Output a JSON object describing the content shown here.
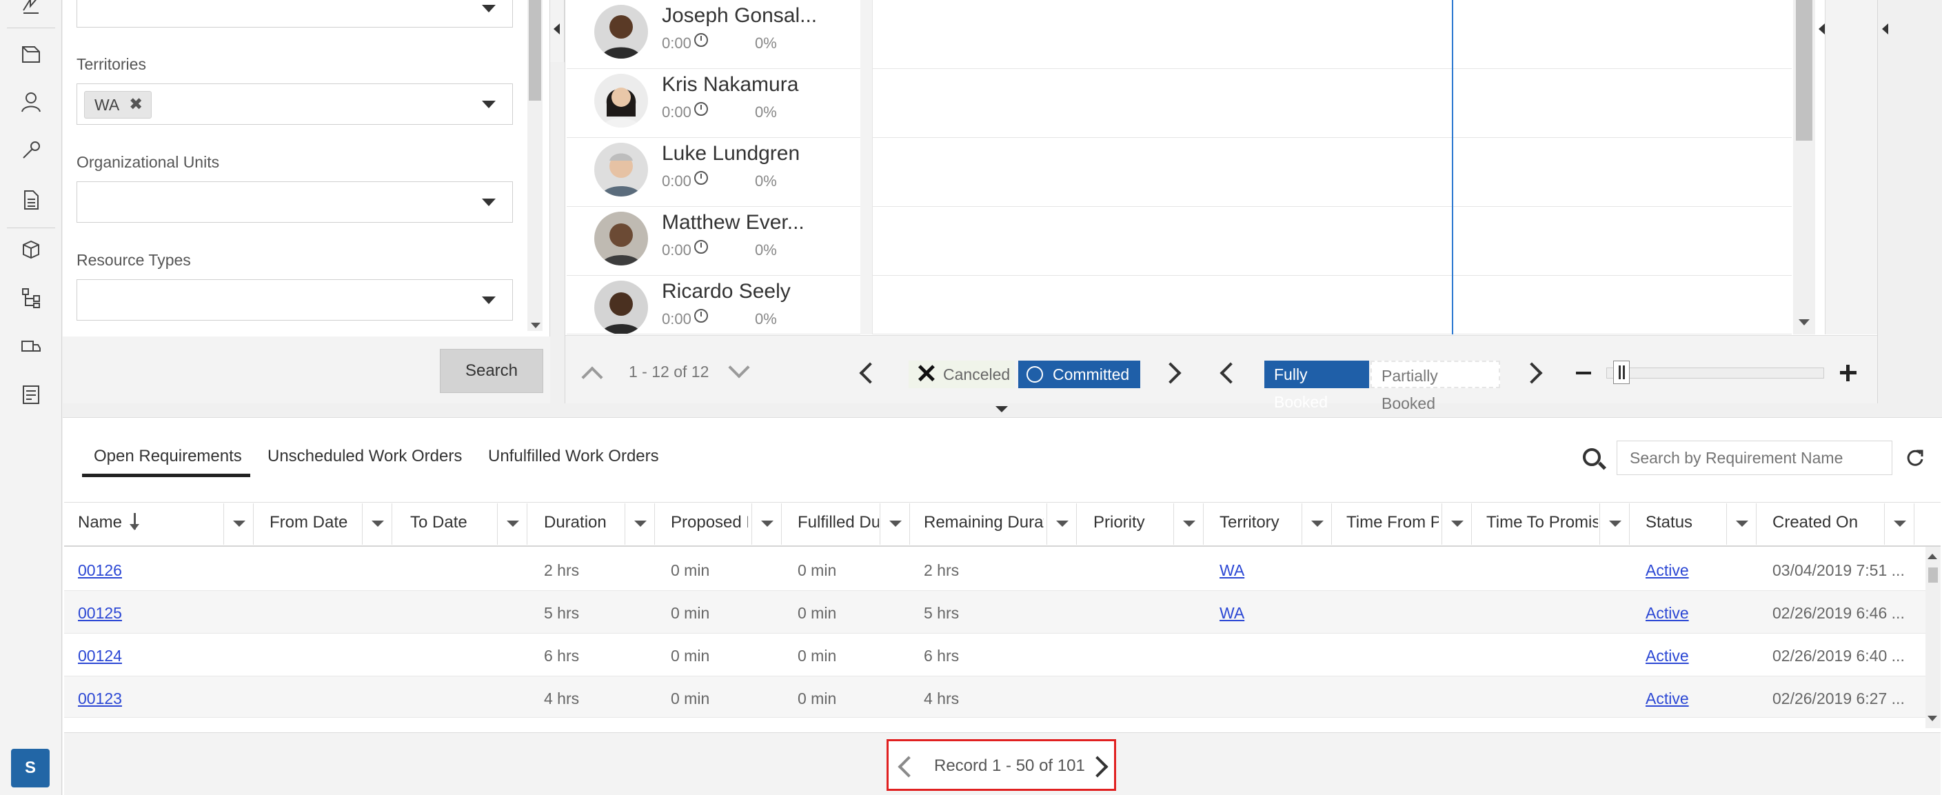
{
  "filters": {
    "territories_label": "Territories",
    "territory_tag": "WA",
    "org_units_label": "Organizational Units",
    "resource_types_label": "Resource Types",
    "search_button": "Search"
  },
  "resources": [
    {
      "name": "Joseph Gonsal...",
      "hours": "0:00",
      "pct": "0%"
    },
    {
      "name": "Kris Nakamura",
      "hours": "0:00",
      "pct": "0%"
    },
    {
      "name": "Luke Lundgren",
      "hours": "0:00",
      "pct": "0%"
    },
    {
      "name": "Matthew Ever...",
      "hours": "0:00",
      "pct": "0%"
    },
    {
      "name": "Ricardo Seely",
      "hours": "0:00",
      "pct": "0%"
    }
  ],
  "board_toolbar": {
    "page_count": "1 - 12 of 12",
    "legend_canceled": "Canceled",
    "legend_committed": "Committed",
    "legend_fully_booked": "Fully Booked",
    "legend_partially_booked": "Partially Booked"
  },
  "user_badge": "S",
  "requirements": {
    "tabs": [
      "Open Requirements",
      "Unscheduled Work Orders",
      "Unfulfilled Work Orders"
    ],
    "search_placeholder": "Search by Requirement Name",
    "columns": [
      "Name",
      "From Date",
      "To Date",
      "Duration",
      "Proposed D",
      "Fulfilled Du",
      "Remaining Durat",
      "Priority",
      "Territory",
      "Time From P",
      "Time To Promis",
      "Status",
      "Created On"
    ],
    "rows": [
      {
        "name": "00126",
        "duration": "2 hrs",
        "proposed": "0 min",
        "fulfilled": "0 min",
        "remaining": "2 hrs",
        "territory": "WA",
        "status": "Active",
        "created": "03/04/2019 7:51 ..."
      },
      {
        "name": "00125",
        "duration": "5 hrs",
        "proposed": "0 min",
        "fulfilled": "0 min",
        "remaining": "5 hrs",
        "territory": "WA",
        "status": "Active",
        "created": "02/26/2019 6:46 ..."
      },
      {
        "name": "00124",
        "duration": "6 hrs",
        "proposed": "0 min",
        "fulfilled": "0 min",
        "remaining": "6 hrs",
        "territory": "",
        "status": "Active",
        "created": "02/26/2019 6:40 ..."
      },
      {
        "name": "00123",
        "duration": "4 hrs",
        "proposed": "0 min",
        "fulfilled": "0 min",
        "remaining": "4 hrs",
        "territory": "",
        "status": "Active",
        "created": "02/26/2019 6:27 ..."
      }
    ],
    "pager_text": "Record 1 - 50 of 101"
  },
  "colors": {
    "accent": "#1f5fa8",
    "link": "#2b47d4",
    "now_line": "#2e7ad1",
    "pager_highlight": "#e02020"
  },
  "icons": [
    "lightning-icon",
    "book-icon",
    "person-icon",
    "wrench-icon",
    "document-icon",
    "boxes-icon",
    "hierarchy-icon",
    "truck-icon",
    "checklist-icon",
    "clock-icon",
    "search-icon",
    "refresh-icon"
  ]
}
